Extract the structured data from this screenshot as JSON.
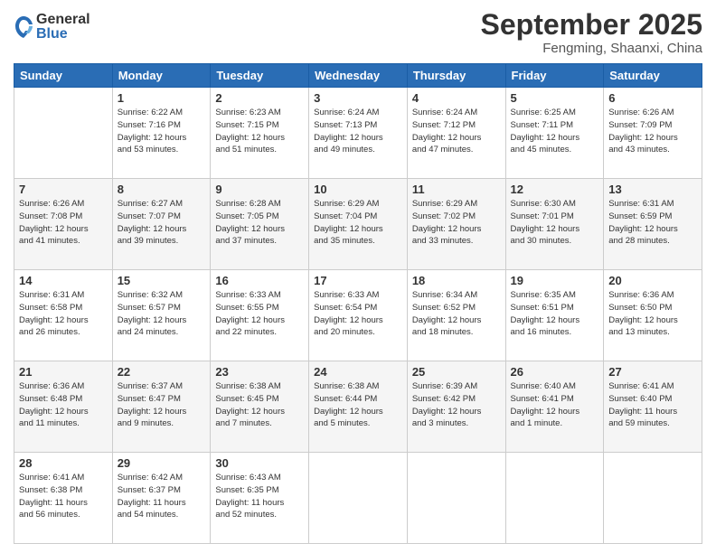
{
  "logo": {
    "general": "General",
    "blue": "Blue"
  },
  "header": {
    "month": "September 2025",
    "location": "Fengming, Shaanxi, China"
  },
  "columns": [
    "Sunday",
    "Monday",
    "Tuesday",
    "Wednesday",
    "Thursday",
    "Friday",
    "Saturday"
  ],
  "weeks": [
    [
      {
        "day": "",
        "info": ""
      },
      {
        "day": "1",
        "info": "Sunrise: 6:22 AM\nSunset: 7:16 PM\nDaylight: 12 hours\nand 53 minutes."
      },
      {
        "day": "2",
        "info": "Sunrise: 6:23 AM\nSunset: 7:15 PM\nDaylight: 12 hours\nand 51 minutes."
      },
      {
        "day": "3",
        "info": "Sunrise: 6:24 AM\nSunset: 7:13 PM\nDaylight: 12 hours\nand 49 minutes."
      },
      {
        "day": "4",
        "info": "Sunrise: 6:24 AM\nSunset: 7:12 PM\nDaylight: 12 hours\nand 47 minutes."
      },
      {
        "day": "5",
        "info": "Sunrise: 6:25 AM\nSunset: 7:11 PM\nDaylight: 12 hours\nand 45 minutes."
      },
      {
        "day": "6",
        "info": "Sunrise: 6:26 AM\nSunset: 7:09 PM\nDaylight: 12 hours\nand 43 minutes."
      }
    ],
    [
      {
        "day": "7",
        "info": "Sunrise: 6:26 AM\nSunset: 7:08 PM\nDaylight: 12 hours\nand 41 minutes."
      },
      {
        "day": "8",
        "info": "Sunrise: 6:27 AM\nSunset: 7:07 PM\nDaylight: 12 hours\nand 39 minutes."
      },
      {
        "day": "9",
        "info": "Sunrise: 6:28 AM\nSunset: 7:05 PM\nDaylight: 12 hours\nand 37 minutes."
      },
      {
        "day": "10",
        "info": "Sunrise: 6:29 AM\nSunset: 7:04 PM\nDaylight: 12 hours\nand 35 minutes."
      },
      {
        "day": "11",
        "info": "Sunrise: 6:29 AM\nSunset: 7:02 PM\nDaylight: 12 hours\nand 33 minutes."
      },
      {
        "day": "12",
        "info": "Sunrise: 6:30 AM\nSunset: 7:01 PM\nDaylight: 12 hours\nand 30 minutes."
      },
      {
        "day": "13",
        "info": "Sunrise: 6:31 AM\nSunset: 6:59 PM\nDaylight: 12 hours\nand 28 minutes."
      }
    ],
    [
      {
        "day": "14",
        "info": "Sunrise: 6:31 AM\nSunset: 6:58 PM\nDaylight: 12 hours\nand 26 minutes."
      },
      {
        "day": "15",
        "info": "Sunrise: 6:32 AM\nSunset: 6:57 PM\nDaylight: 12 hours\nand 24 minutes."
      },
      {
        "day": "16",
        "info": "Sunrise: 6:33 AM\nSunset: 6:55 PM\nDaylight: 12 hours\nand 22 minutes."
      },
      {
        "day": "17",
        "info": "Sunrise: 6:33 AM\nSunset: 6:54 PM\nDaylight: 12 hours\nand 20 minutes."
      },
      {
        "day": "18",
        "info": "Sunrise: 6:34 AM\nSunset: 6:52 PM\nDaylight: 12 hours\nand 18 minutes."
      },
      {
        "day": "19",
        "info": "Sunrise: 6:35 AM\nSunset: 6:51 PM\nDaylight: 12 hours\nand 16 minutes."
      },
      {
        "day": "20",
        "info": "Sunrise: 6:36 AM\nSunset: 6:50 PM\nDaylight: 12 hours\nand 13 minutes."
      }
    ],
    [
      {
        "day": "21",
        "info": "Sunrise: 6:36 AM\nSunset: 6:48 PM\nDaylight: 12 hours\nand 11 minutes."
      },
      {
        "day": "22",
        "info": "Sunrise: 6:37 AM\nSunset: 6:47 PM\nDaylight: 12 hours\nand 9 minutes."
      },
      {
        "day": "23",
        "info": "Sunrise: 6:38 AM\nSunset: 6:45 PM\nDaylight: 12 hours\nand 7 minutes."
      },
      {
        "day": "24",
        "info": "Sunrise: 6:38 AM\nSunset: 6:44 PM\nDaylight: 12 hours\nand 5 minutes."
      },
      {
        "day": "25",
        "info": "Sunrise: 6:39 AM\nSunset: 6:42 PM\nDaylight: 12 hours\nand 3 minutes."
      },
      {
        "day": "26",
        "info": "Sunrise: 6:40 AM\nSunset: 6:41 PM\nDaylight: 12 hours\nand 1 minute."
      },
      {
        "day": "27",
        "info": "Sunrise: 6:41 AM\nSunset: 6:40 PM\nDaylight: 11 hours\nand 59 minutes."
      }
    ],
    [
      {
        "day": "28",
        "info": "Sunrise: 6:41 AM\nSunset: 6:38 PM\nDaylight: 11 hours\nand 56 minutes."
      },
      {
        "day": "29",
        "info": "Sunrise: 6:42 AM\nSunset: 6:37 PM\nDaylight: 11 hours\nand 54 minutes."
      },
      {
        "day": "30",
        "info": "Sunrise: 6:43 AM\nSunset: 6:35 PM\nDaylight: 11 hours\nand 52 minutes."
      },
      {
        "day": "",
        "info": ""
      },
      {
        "day": "",
        "info": ""
      },
      {
        "day": "",
        "info": ""
      },
      {
        "day": "",
        "info": ""
      }
    ]
  ]
}
